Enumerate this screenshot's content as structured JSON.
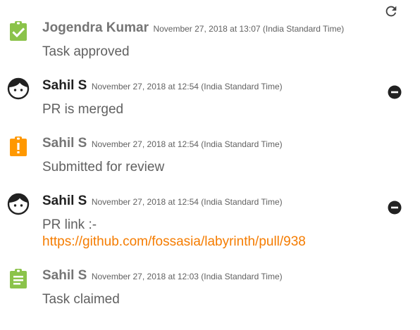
{
  "toolbar": {
    "refresh_icon": "refresh-icon"
  },
  "colors": {
    "approved_icon": "#8bc34a",
    "review_icon": "#ff9800",
    "claimed_icon": "#8bc34a",
    "link": "#f57c00",
    "remove_button": "#212121"
  },
  "activity": [
    {
      "author": "Jogendra Kumar",
      "timestamp": "November 27, 2018 at 13:07 (India Standard Time)",
      "message": "Task approved",
      "icon": "approved-clipboard-icon",
      "removable": false
    },
    {
      "author": "Sahil S",
      "timestamp": "November 27, 2018 at 12:54 (India Standard Time)",
      "message": "PR is merged",
      "icon": "user-avatar-icon",
      "removable": true
    },
    {
      "author": "Sahil S",
      "timestamp": "November 27, 2018 at 12:54 (India Standard Time)",
      "message": "Submitted for review",
      "icon": "review-clipboard-icon",
      "removable": false
    },
    {
      "author": "Sahil S",
      "timestamp": "November 27, 2018 at 12:54 (India Standard Time)",
      "message": "PR link :-",
      "link": "https://github.com/fossasia/labyrinth/pull/938",
      "icon": "user-avatar-icon",
      "removable": true
    },
    {
      "author": "Sahil S",
      "timestamp": "November 27, 2018 at 12:03 (India Standard Time)",
      "message": "Task claimed",
      "icon": "claimed-clipboard-icon",
      "removable": false
    }
  ]
}
